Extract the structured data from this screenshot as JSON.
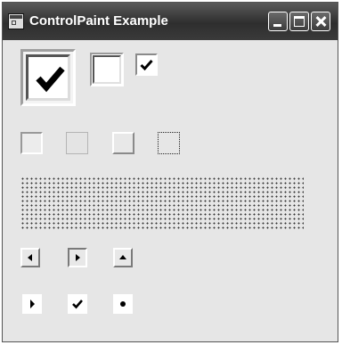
{
  "window": {
    "title": "ControlPaint Example",
    "icon": "app-window-icon",
    "controls": [
      "minimize-icon",
      "maximize-icon",
      "close-icon"
    ]
  },
  "checkboxes": [
    {
      "size": "large",
      "state": "checked",
      "style": "3d"
    },
    {
      "size": "medium",
      "state": "unchecked",
      "style": "3d"
    },
    {
      "size": "small",
      "state": "checked",
      "style": "flat"
    }
  ],
  "buttons": [
    {
      "style": "pushed"
    },
    {
      "style": "flat"
    },
    {
      "style": "normal"
    },
    {
      "style": "focus-rectangle"
    }
  ],
  "grid": {
    "style": "dotted"
  },
  "scroll_buttons": [
    {
      "direction": "left",
      "icon": "arrow-left-icon"
    },
    {
      "direction": "right",
      "icon": "arrow-right-icon",
      "state": "pushed"
    },
    {
      "direction": "up",
      "icon": "arrow-up-icon"
    }
  ],
  "menu_glyphs": [
    {
      "glyph": "arrow",
      "icon": "menu-arrow-icon"
    },
    {
      "glyph": "checkmark",
      "icon": "menu-check-icon"
    },
    {
      "glyph": "bullet",
      "icon": "menu-bullet-icon"
    }
  ]
}
